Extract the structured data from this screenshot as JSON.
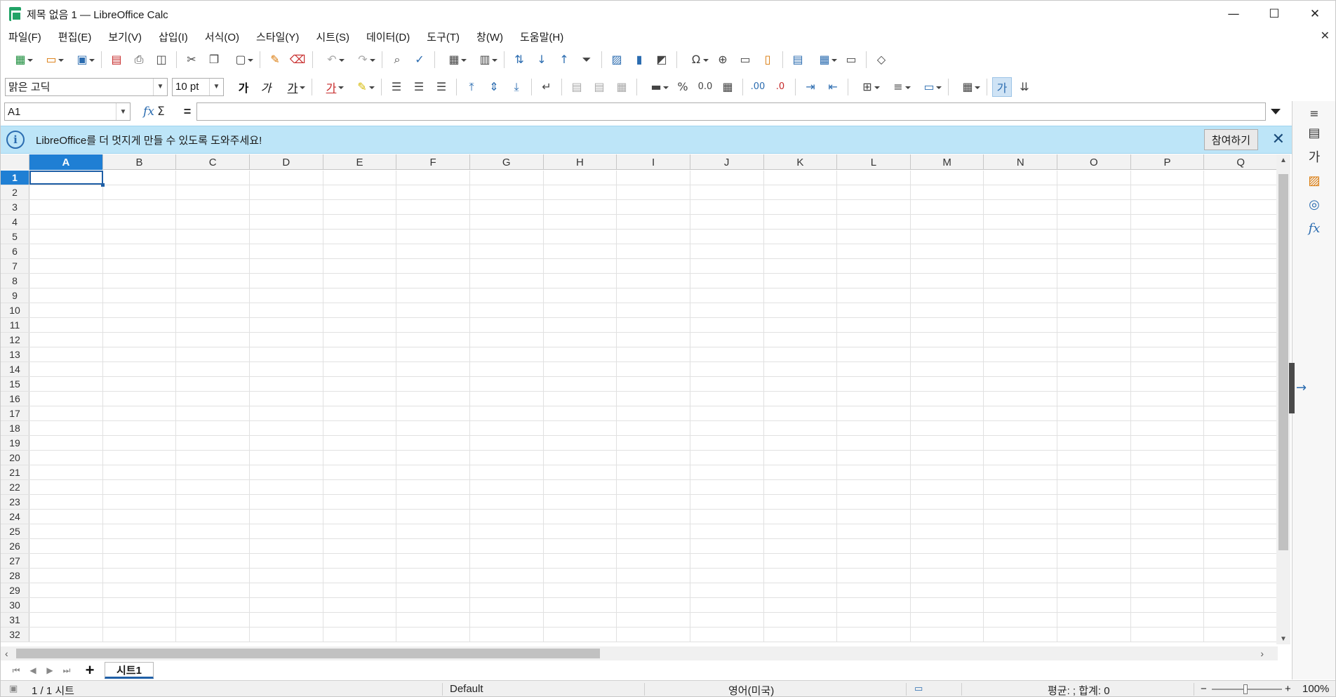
{
  "window": {
    "title": "제목 없음 1 — LibreOffice Calc",
    "controls": [
      "—",
      "☐",
      "✕"
    ]
  },
  "menu": [
    "파일(F)",
    "편집(E)",
    "보기(V)",
    "삽입(I)",
    "서식(O)",
    "스타일(Y)",
    "시트(S)",
    "데이터(D)",
    "도구(T)",
    "창(W)",
    "도움말(H)"
  ],
  "menu_close": "✕",
  "format_toolbar": {
    "font_name": "맑은 고딕",
    "font_size": "10 pt",
    "bold_label": "가",
    "italic_label": "가",
    "underline_label": "가",
    "percent_label": "%",
    "number_label": "0.0",
    "add_decimal_label": ".00",
    "del_decimal_label": ".0"
  },
  "formula_bar": {
    "name_box": "A1",
    "fx": "fx",
    "sum": "Σ",
    "equals": "=",
    "formula": ""
  },
  "infobar": {
    "message": "LibreOffice를 더 멋지게 만들 수 있도록 도와주세요!",
    "button": "참여하기",
    "close": "✕",
    "icon": "i"
  },
  "columns": [
    "A",
    "B",
    "C",
    "D",
    "E",
    "F",
    "G",
    "H",
    "I",
    "J",
    "K",
    "L",
    "M",
    "N",
    "O",
    "P",
    "Q"
  ],
  "rows": [
    "1",
    "2",
    "3",
    "4",
    "5",
    "6",
    "7",
    "8",
    "9",
    "10",
    "11",
    "12",
    "13",
    "14",
    "15",
    "16",
    "17",
    "18",
    "19",
    "20",
    "21",
    "22",
    "23",
    "24",
    "25",
    "26",
    "27",
    "28",
    "29",
    "30",
    "31",
    "32"
  ],
  "selected_cell": "A1",
  "sheet_tabs": {
    "add": "+",
    "tabs": [
      "시트1"
    ]
  },
  "status": {
    "sheet_info": "1 / 1 시트",
    "page_style": "Default",
    "language": "영어(미국)",
    "summary": "평균: ; 합계: 0",
    "zoom_minus": "−",
    "zoom_plus": "+",
    "zoom": "100%"
  },
  "colors": {
    "selection": "#1f7fd4",
    "infobar": "#bde5f8",
    "accent": "#2b6cb0"
  }
}
